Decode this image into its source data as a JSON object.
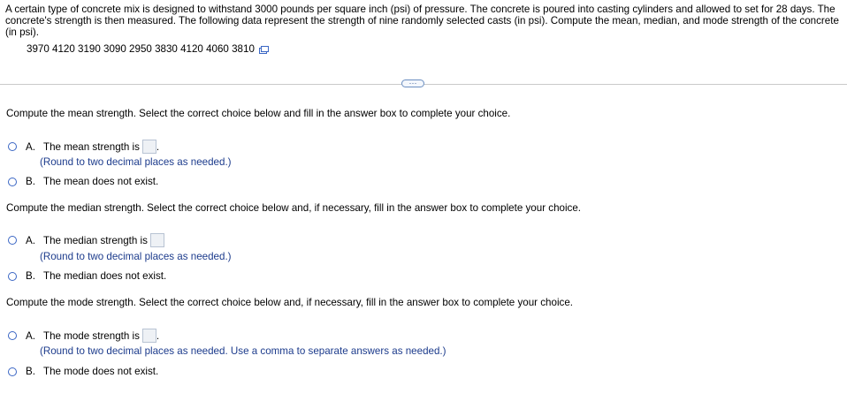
{
  "problem": {
    "text": "A certain type of concrete mix is designed to withstand 3000 pounds per square inch (psi) of pressure. The concrete is poured into casting cylinders and allowed to set for 28 days. The concrete's strength is then measured. The following data represent the strength of nine randomly selected casts (in psi). Compute the mean, median, and mode strength of the concrete (in psi).",
    "data_values": "3970 4120 3190 3090 2950 3830 4120 4060 3810",
    "copy_icon": "copy-data-icon"
  },
  "expand_button": {
    "label": "···"
  },
  "parts": [
    {
      "question": "Compute the mean strength. Select the correct choice below and fill in the answer box to complete your choice.",
      "choice_a_letter": "A.",
      "choice_a_text": "The mean strength is",
      "choice_a_suffix": ".",
      "choice_a_hint": "(Round to two decimal places as needed.)",
      "choice_b_letter": "B.",
      "choice_b_text": "The mean does not exist."
    },
    {
      "question": "Compute the median strength. Select the correct choice below and, if necessary, fill in the answer box to complete your choice.",
      "choice_a_letter": "A.",
      "choice_a_text": "The median strength is",
      "choice_a_suffix": "",
      "choice_a_hint": "(Round to two decimal places as needed.)",
      "choice_b_letter": "B.",
      "choice_b_text": "The median does not exist."
    },
    {
      "question": "Compute the mode strength. Select the correct choice below and, if necessary, fill in the answer box to complete your choice.",
      "choice_a_letter": "A.",
      "choice_a_text": "The mode strength is",
      "choice_a_suffix": ".",
      "choice_a_hint": "(Round to two decimal places as needed. Use a comma to separate answers as needed.)",
      "choice_b_letter": "B.",
      "choice_b_text": "The mode does not exist."
    }
  ]
}
